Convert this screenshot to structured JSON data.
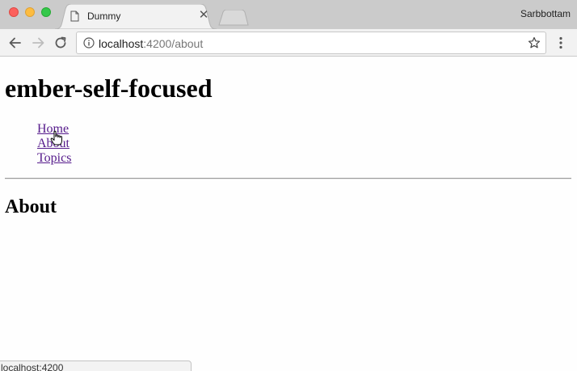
{
  "browser": {
    "tab": {
      "title": "Dummy"
    },
    "profile_name": "Sarbbottam",
    "address": {
      "host": "localhost",
      "rest": ":4200/about"
    },
    "status_url": "localhost:4200"
  },
  "page": {
    "heading": "ember-self-focused",
    "nav_links": [
      {
        "label": "Home"
      },
      {
        "label": "About"
      },
      {
        "label": "Topics"
      }
    ],
    "section_title": "About"
  },
  "colors": {
    "link_visited": "#551a8b",
    "close": "#fc605c",
    "minimize": "#fdbc40",
    "maximize": "#34c84a"
  }
}
